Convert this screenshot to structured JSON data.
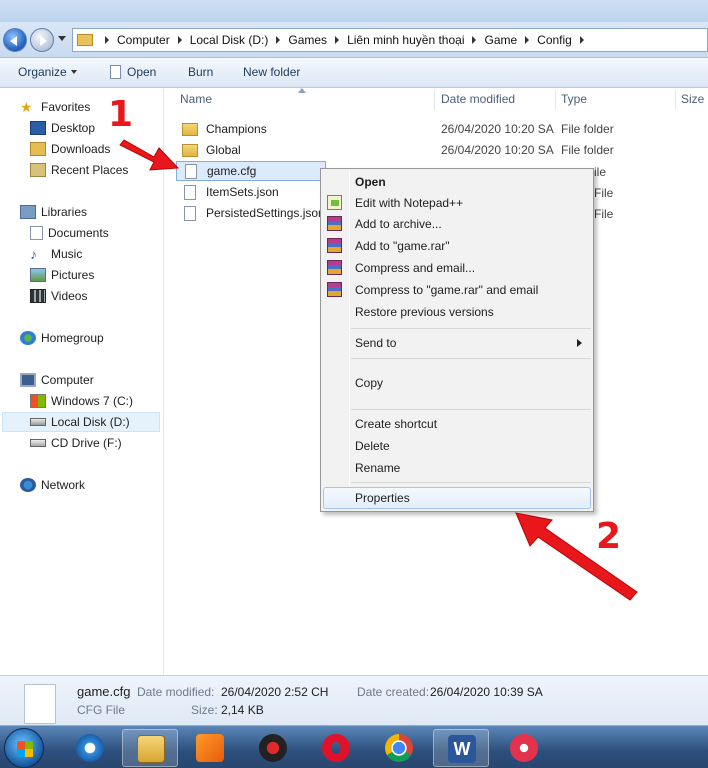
{
  "address_bar": {
    "crumbs": [
      "Computer",
      "Local Disk (D:)",
      "Games",
      "Liên minh huyền thoại",
      "Game",
      "Config"
    ]
  },
  "toolbar": {
    "organize": "Organize",
    "open": "Open",
    "burn": "Burn",
    "new_folder": "New folder"
  },
  "sidebar": {
    "favorites": "Favorites",
    "desktop": "Desktop",
    "downloads": "Downloads",
    "recent_places": "Recent Places",
    "libraries": "Libraries",
    "documents": "Documents",
    "music": "Music",
    "pictures": "Pictures",
    "videos": "Videos",
    "homegroup": "Homegroup",
    "computer": "Computer",
    "windows7": "Windows 7 (C:)",
    "local_disk_d": "Local Disk (D:)",
    "cd_drive": "CD Drive (F:)",
    "network": "Network"
  },
  "columns": {
    "name": "Name",
    "date": "Date modified",
    "type": "Type",
    "size": "Size"
  },
  "files": [
    {
      "name": "Champions",
      "date": "26/04/2020 10:20 SA",
      "type": "File folder"
    },
    {
      "name": "Global",
      "date": "26/04/2020 10:20 SA",
      "type": "File folder"
    },
    {
      "name": "game.cfg",
      "date": "",
      "type": "ile"
    },
    {
      "name": "ItemSets.json",
      "date": "",
      "type": "File"
    },
    {
      "name": "PersistedSettings.json",
      "date": "",
      "type": "File"
    }
  ],
  "context_menu": {
    "open": "Open",
    "edit_notepad": "Edit with Notepad++",
    "add_archive": "Add to archive...",
    "add_rar": "Add to \"game.rar\"",
    "compress_email": "Compress and email...",
    "compress_rar_email": "Compress to \"game.rar\" and email",
    "restore": "Restore previous versions",
    "send_to": "Send to",
    "copy": "Copy",
    "create_shortcut": "Create shortcut",
    "delete": "Delete",
    "rename": "Rename",
    "properties": "Properties"
  },
  "details_pane": {
    "filename": "game.cfg",
    "date_modified_label": "Date modified:",
    "date_modified": "26/04/2020 2:52 CH",
    "date_created_label": "Date created:",
    "date_created": "26/04/2020 10:39 SA",
    "file_type": "CFG File",
    "size_label": "Size:",
    "size": "2,14 KB"
  },
  "annotations": {
    "step1": "1",
    "step2": "2"
  },
  "colors": {
    "annotation_red": "#e8171b",
    "selection_blue": "#dcebfc"
  }
}
